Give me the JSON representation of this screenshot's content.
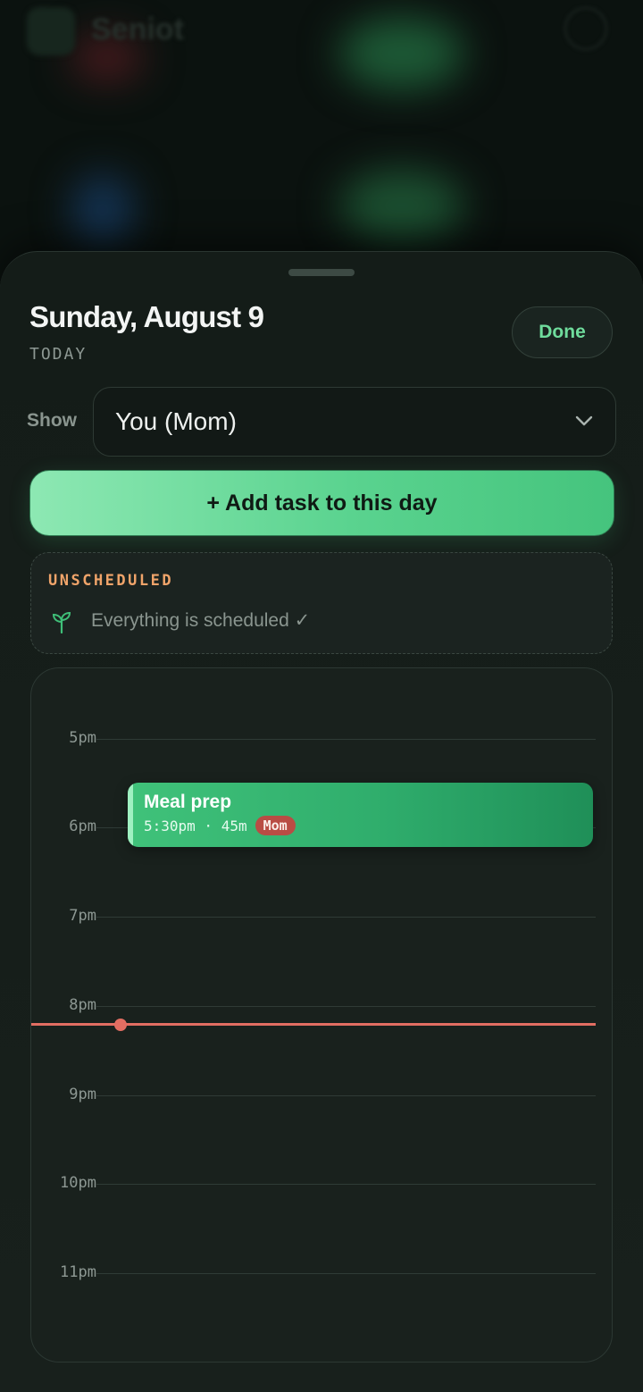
{
  "background_app": {
    "title": "Seniot"
  },
  "sheet": {
    "date_title": "Sunday, August 9",
    "date_subtitle": "TODAY",
    "done_label": "Done",
    "show_label": "Show",
    "show_selected": "You (Mom)",
    "add_task_label": "+ Add task to this day",
    "unscheduled": {
      "title": "UNSCHEDULED",
      "empty_text": "Everything is scheduled ✓",
      "icon": "sprout-icon"
    },
    "timeline": {
      "hours": [
        "5pm",
        "6pm",
        "7pm",
        "8pm",
        "9pm",
        "10pm",
        "11pm"
      ],
      "events": [
        {
          "title": "Meal prep",
          "meta": "5:30pm · 45m",
          "badge": "Mom"
        }
      ],
      "now_indicator_color": "#e26e62"
    }
  },
  "colors": {
    "accent_green": "#4fce89",
    "done_text": "#6fdc9c",
    "unscheduled_title": "#f0a46a",
    "badge": "#b94c44"
  }
}
